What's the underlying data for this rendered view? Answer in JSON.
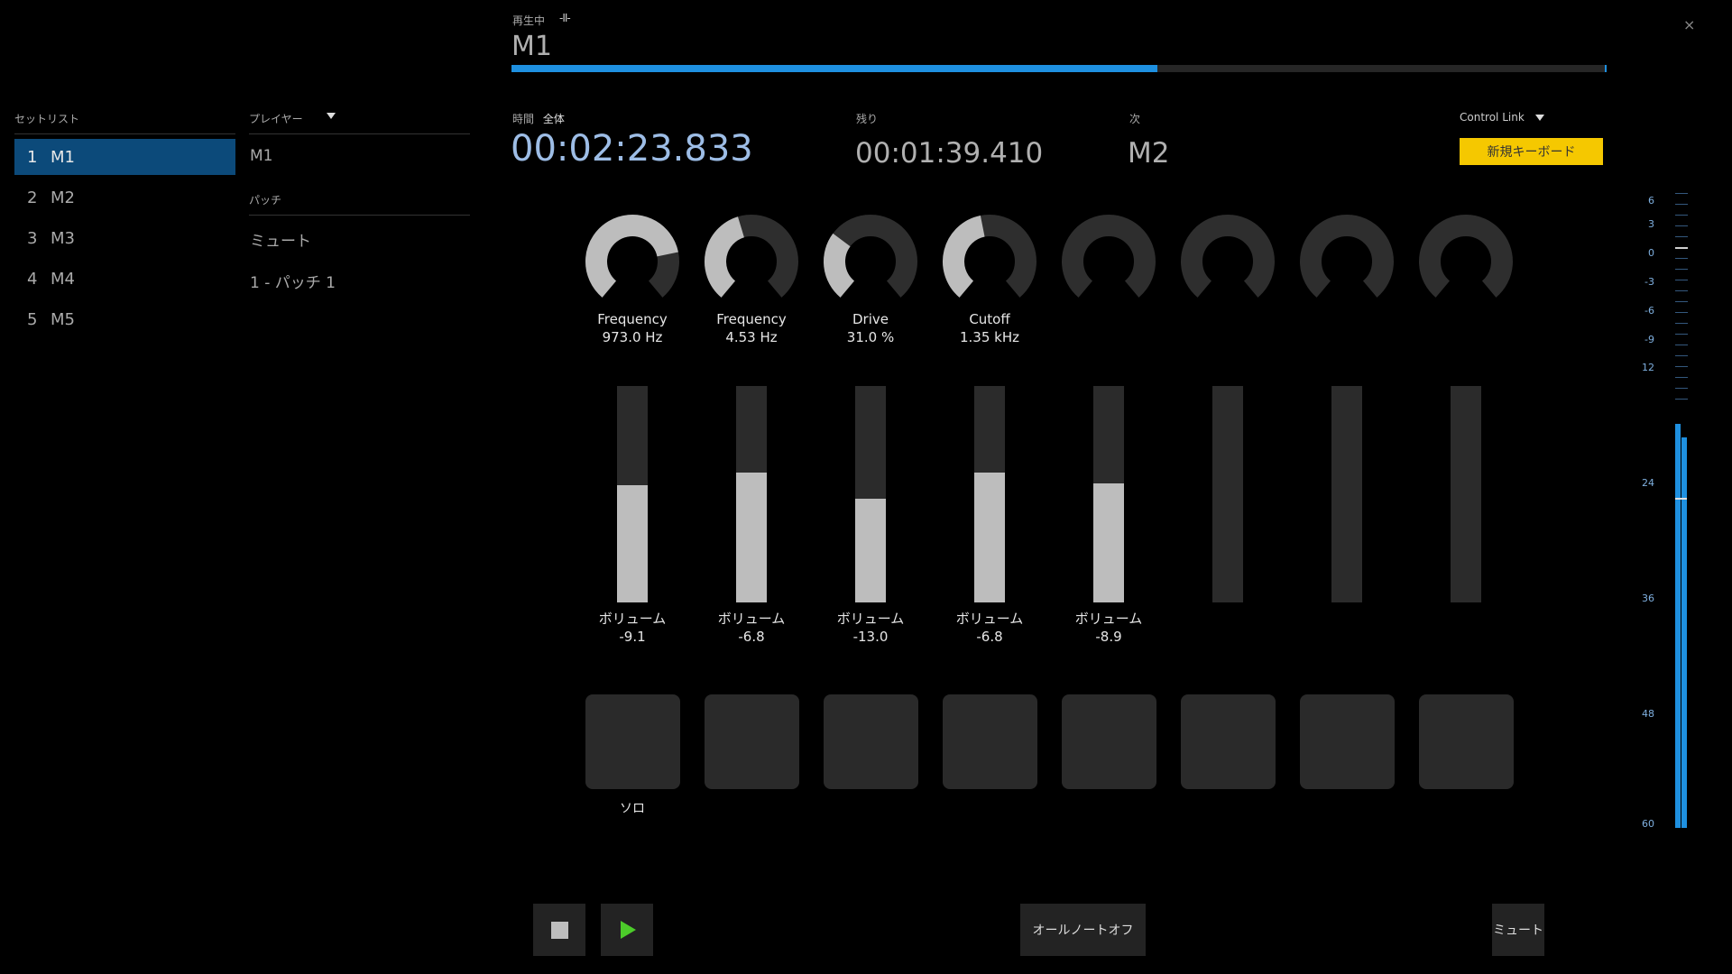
{
  "window": {
    "close_label": "×"
  },
  "now_playing": {
    "label": "再生中",
    "state_icon": "-II-",
    "title": "M1",
    "progress": 0.59
  },
  "setlist": {
    "header": "セットリスト",
    "items": [
      {
        "num": "1",
        "name": "M1"
      },
      {
        "num": "2",
        "name": "M2"
      },
      {
        "num": "3",
        "name": "M3"
      },
      {
        "num": "4",
        "name": "M4"
      },
      {
        "num": "5",
        "name": "M5"
      }
    ],
    "selected_index": 0
  },
  "player": {
    "header": "プレイヤー",
    "value": "M1"
  },
  "patch": {
    "header": "パッチ",
    "items": [
      "ミュート",
      "1 - パッチ 1"
    ]
  },
  "time": {
    "label": "時間",
    "mode": "全体",
    "value": "00:02:23.833",
    "remaining_label": "残り",
    "remaining": "00:01:39.410",
    "next_label": "次",
    "next": "M2"
  },
  "control_link": {
    "label": "Control Link",
    "button": "新規キーボード"
  },
  "knobs": [
    {
      "name": "Frequency",
      "value": "973.0 Hz",
      "level": 0.78
    },
    {
      "name": "Frequency",
      "value": "4.53 Hz",
      "level": 0.44
    },
    {
      "name": "Drive",
      "value": "31.0 %",
      "level": 0.31
    },
    {
      "name": "Cutoff",
      "value": "1.35 kHz",
      "level": 0.46
    },
    {
      "name": "",
      "value": "",
      "level": 0
    },
    {
      "name": "",
      "value": "",
      "level": 0
    },
    {
      "name": "",
      "value": "",
      "level": 0
    },
    {
      "name": "",
      "value": "",
      "level": 0
    }
  ],
  "faders": [
    {
      "name": "ボリューム",
      "value": "-9.1",
      "level": 0.54
    },
    {
      "name": "ボリューム",
      "value": "-6.8",
      "level": 0.6
    },
    {
      "name": "ボリューム",
      "value": "-13.0",
      "level": 0.48
    },
    {
      "name": "ボリューム",
      "value": "-6.8",
      "level": 0.6
    },
    {
      "name": "ボリューム",
      "value": "-8.9",
      "level": 0.55
    },
    {
      "name": "",
      "value": "",
      "level": 0
    },
    {
      "name": "",
      "value": "",
      "level": 0
    },
    {
      "name": "",
      "value": "",
      "level": 0
    }
  ],
  "pads": [
    {
      "label": "ソロ"
    },
    {
      "label": ""
    },
    {
      "label": ""
    },
    {
      "label": ""
    },
    {
      "label": ""
    },
    {
      "label": ""
    },
    {
      "label": ""
    },
    {
      "label": ""
    }
  ],
  "transport": {
    "stop_icon": "stop-icon",
    "play_icon": "play-icon",
    "all_notes_off": "オールノートオフ",
    "mute": "ミュート"
  },
  "meter": {
    "scale": [
      "6",
      "3",
      "0",
      "-3",
      "-6",
      "-9",
      "12",
      "24",
      "36",
      "48",
      "60"
    ],
    "level_left": 0.61,
    "level_right": 0.59
  },
  "colors": {
    "accent": "#1e90e0",
    "selected": "#0c4a7a",
    "button_yellow": "#f5c800",
    "play_green": "#4ccc2a"
  }
}
